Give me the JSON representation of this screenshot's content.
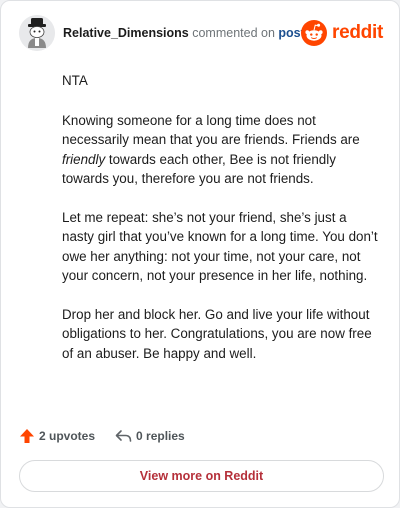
{
  "comment": {
    "author": "Relative_Dimensions",
    "action_text": "commented on",
    "post_link": "post",
    "brand": "reddit",
    "paragraphs": {
      "p1": "NTA",
      "p2_a": "Knowing someone for a long time does not necessarily mean that you are friends. Friends are ",
      "p2_em": "friendly",
      "p2_b": " towards each other, Bee is not friendly towards you, therefore you are not friends.",
      "p3": "Let me repeat: she’s not your friend, she’s just a nasty girl that you’ve known for a long time. You don’t owe her anything: not your time, not your care, not your concern, not your presence in her life, nothing.",
      "p4": "Drop her and block her. Go and live your life without obligations to her. Congratulations, you are now free of an abuser. Be happy and well."
    },
    "upvotes_label": "2 upvotes",
    "replies_label": "0 replies",
    "view_more_label": "View more on Reddit"
  },
  "icons": {
    "avatar": "avatar-icon",
    "logo": "reddit-logo-icon",
    "upvote": "upvote-arrow-icon",
    "reply": "reply-arrow-icon"
  },
  "colors": {
    "brand": "#ff4500",
    "link": "#1c4f8f",
    "view_more": "#b5303a",
    "muted": "#6e7478"
  }
}
